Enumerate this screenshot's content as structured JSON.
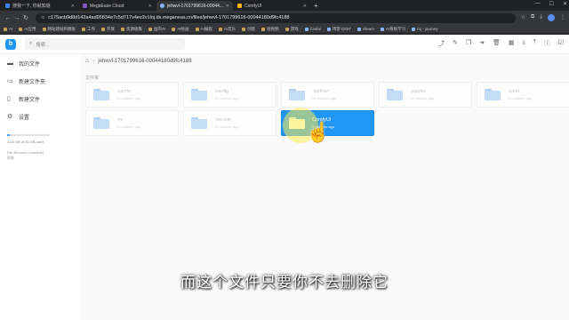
{
  "browser": {
    "tabs": [
      {
        "label": "搜我一下, 你就知道",
        "active": false,
        "color": "#4285f4"
      },
      {
        "label": "MegaEase Cloud",
        "active": false,
        "color": "#7e57c2"
      },
      {
        "label": "jehwvl-1701799616-00044...",
        "active": true,
        "color": "#8ab4f8"
      },
      {
        "label": "ComfyUI",
        "active": false,
        "color": "#f4b400"
      }
    ],
    "new_tab": "+",
    "url": "c175acb9d8d142a4ad95834e7c5d717v4ev2v1lnj.ds.meganeas.cn/files/jehwvl-1701799616-00044180d9fc4188",
    "bookmarks": [
      {
        "label": "AI",
        "folder": true
      },
      {
        "label": "AI应用",
        "folder": true
      },
      {
        "label": "网站建站和模板",
        "folder": true
      },
      {
        "label": "工作",
        "folder": true
      },
      {
        "label": "开发",
        "folder": true
      },
      {
        "label": "资源收集",
        "folder": true
      },
      {
        "label": "国内AI",
        "folder": true
      },
      {
        "label": "AI绘画",
        "folder": true
      },
      {
        "label": "AI编程",
        "folder": true
      },
      {
        "label": "AI音乐",
        "folder": true
      },
      {
        "label": "创意",
        "folder": true
      },
      {
        "label": "短视频",
        "folder": true
      },
      {
        "label": "游戏",
        "folder": true
      },
      {
        "label": "Civitai",
        "folder": false
      },
      {
        "label": "博客-DOIT",
        "folder": false
      },
      {
        "label": "dream",
        "folder": false
      },
      {
        "label": "AI系统学习",
        "folder": false
      },
      {
        "label": "mj - journey",
        "folder": false
      }
    ]
  },
  "app": {
    "logo_text": "b",
    "search_placeholder": "搜索...",
    "sidebar": [
      {
        "label": "我的文件",
        "icon": "folder-icon"
      },
      {
        "label": "新建文件夹",
        "icon": "new-folder-icon"
      },
      {
        "label": "新建文件",
        "icon": "new-file-icon"
      },
      {
        "label": "设置",
        "icon": "settings-icon"
      }
    ],
    "quota": {
      "text": "3.54 GB of 50 GB used",
      "fraction": 0.07
    },
    "credit": [
      "File Browser (unstable)",
      "帮助"
    ],
    "breadcrumb": "jehwvl-1701799616-00044180d9fc4188",
    "section_label": "文件夹",
    "folders": [
      {
        "name": ".cache",
        "date": "21 minutes ago",
        "selected": false
      },
      {
        "name": ".config",
        "date": "21 minutes ago",
        "selected": false
      },
      {
        "name": ".ipython",
        "date": "21 minutes ago",
        "selected": false
      },
      {
        "name": ".jupyter",
        "date": "21 minutes ago",
        "selected": false
      },
      {
        "name": ".local",
        "date": "21 minutes ago",
        "selected": false
      },
      {
        "name": ".nv",
        "date": "21 minutes ago",
        "selected": false
      },
      {
        "name": ".vscode",
        "date": "21 minutes ago",
        "selected": false
      },
      {
        "name": "ComfyUI",
        "date": "3 minutes ago",
        "selected": true
      }
    ]
  },
  "subtitle": "而这个文件只要你不去删除它"
}
